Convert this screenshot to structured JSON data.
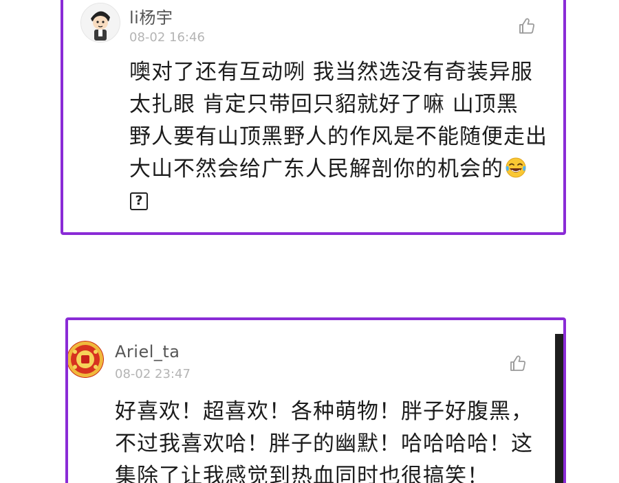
{
  "comments": [
    {
      "username": "li杨宇",
      "time": "08-02 16:46",
      "lines": [
        "噢对了还有互动咧  我当然选没有奇装异服",
        "太扎眼  肯定只带回只貂就好了嘛  山顶黑",
        "野人要有山顶黑野人的作风是不能随便走出",
        "大山不然会给广东人民解剖你的机会的"
      ],
      "trailing_emoji": "laughing-tears-emoji",
      "placeholder_glyph": "?",
      "like_icon": "thumbs-up-icon"
    },
    {
      "username": "Ariel_ta",
      "time": "08-02 23:47",
      "lines": [
        "好喜欢！超喜欢！各种萌物！胖子好腹黑，",
        "不过我喜欢哈！胖子的幽默！哈哈哈哈！这",
        "集除了让我感觉到热血同时也很搞笑！"
      ],
      "like_icon": "thumbs-up-icon"
    }
  ],
  "colors": {
    "card_border": "#8a2bd6",
    "username": "#555555",
    "timestamp": "#b4b4b4",
    "comment_text": "#1c1c1c"
  }
}
